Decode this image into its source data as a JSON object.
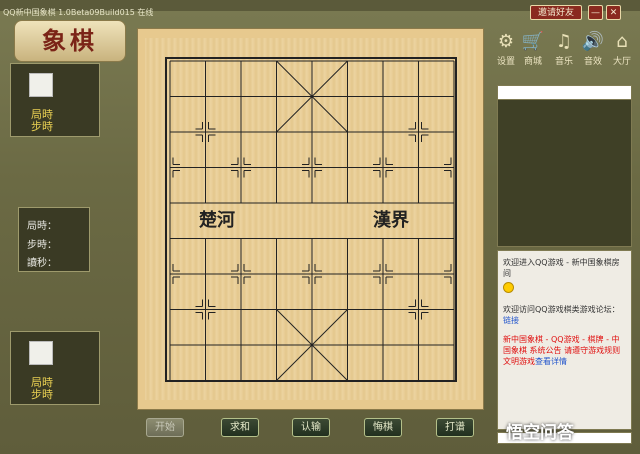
{
  "window": {
    "title": "QQ新中国象棋 1.0Beta09Build015 在线",
    "invite_label": "邀请好友",
    "minimize_label": "—",
    "close_label": "✕"
  },
  "logo": {
    "text": "象棋"
  },
  "top_player": {
    "game_time_label": "局時",
    "step_time_label": "步時"
  },
  "middle_stats": {
    "game_time_label": "局時：",
    "step_time_label": "步時：",
    "read_sec_label": "讀秒："
  },
  "bottom_player": {
    "game_time_label": "局時",
    "step_time_label": "步時"
  },
  "board": {
    "river_left": "楚河",
    "river_right": "漢界"
  },
  "buttons": [
    {
      "label": "开始",
      "enabled": false
    },
    {
      "label": "求和",
      "enabled": true
    },
    {
      "label": "认输",
      "enabled": true
    },
    {
      "label": "悔棋",
      "enabled": true
    },
    {
      "label": "打谱",
      "enabled": true
    }
  ],
  "toolbar": [
    {
      "icon": "gear-icon",
      "label": "设置"
    },
    {
      "icon": "cart-icon",
      "label": "商城"
    },
    {
      "icon": "music-icon",
      "label": "音乐"
    },
    {
      "icon": "speaker-icon",
      "label": "音效"
    },
    {
      "icon": "home-icon",
      "label": "大厅"
    }
  ],
  "chat": {
    "welcome": "欢迎进入QQ游戏 - 新中国象棋房间",
    "forum": "欢迎访问QQ游戏棋类游戏论坛：",
    "forum_link": "链接",
    "notice": "新中国象棋 - QQ游戏 - 棋牌 - 中国象棋 系统公告 请遵守游戏规则 文明游戏",
    "notice_link": "查看详情"
  },
  "watermark": {
    "text": "悟空问答"
  }
}
